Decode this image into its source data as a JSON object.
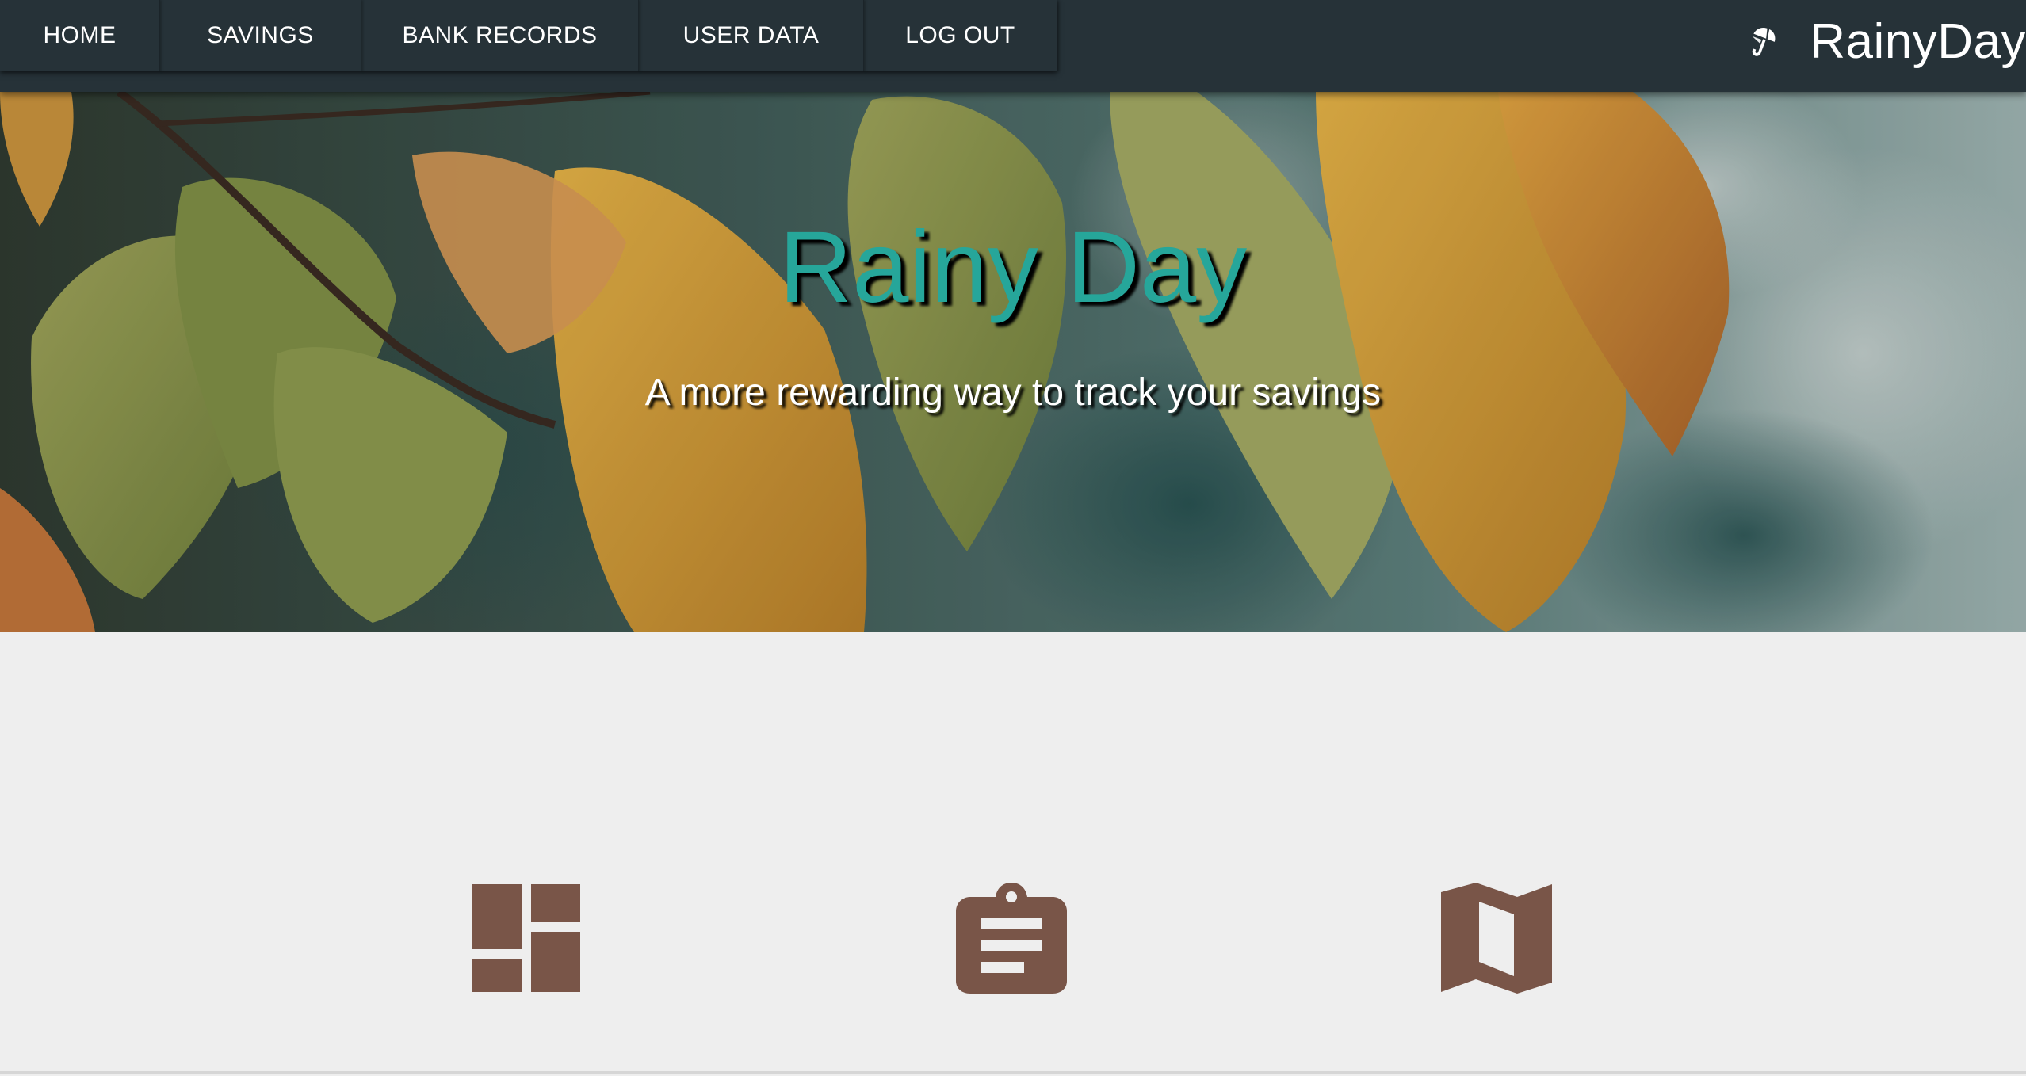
{
  "nav": {
    "items": [
      {
        "label": "HOME"
      },
      {
        "label": "SAVINGS"
      },
      {
        "label": "BANK RECORDS"
      },
      {
        "label": "USER DATA"
      },
      {
        "label": "LOG OUT"
      }
    ]
  },
  "brand": {
    "name": "RainyDay",
    "icon": "umbrella-icon"
  },
  "hero": {
    "title": "Rainy Day",
    "subtitle": "A more rewarding way to track your savings"
  },
  "features": {
    "icons": [
      "dashboard-icon",
      "clipboard-icon",
      "map-icon"
    ]
  },
  "colors": {
    "navbar": "#263238",
    "accent": "#26a69a",
    "icon": "#795548",
    "background": "#eeeeee"
  }
}
